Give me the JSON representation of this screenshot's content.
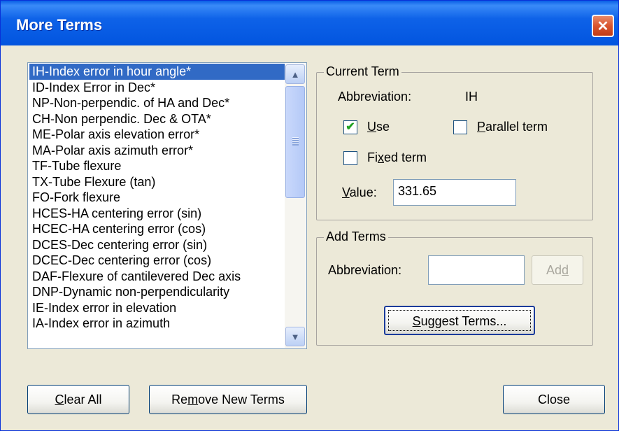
{
  "window": {
    "title": "More Terms",
    "close_glyph": "✕"
  },
  "terms_list": {
    "items": [
      "IH-Index error in hour angle*",
      "ID-Index Error in Dec*",
      "NP-Non-perpendic. of HA and Dec*",
      "CH-Non perpendic. Dec & OTA*",
      "ME-Polar axis elevation error*",
      "MA-Polar axis azimuth error*",
      "TF-Tube flexure",
      "TX-Tube Flexure (tan)",
      "FO-Fork flexure",
      "HCES-HA centering error (sin)",
      "HCEC-HA centering error (cos)",
      "DCES-Dec centering error (sin)",
      "DCEC-Dec centering error (cos)",
      "DAF-Flexure of cantilevered Dec axis",
      "DNP-Dynamic non-perpendicularity",
      "IE-Index error in elevation",
      "IA-Index error in azimuth"
    ],
    "selected_index": 0,
    "scroll_up_glyph": "▲",
    "scroll_down_glyph": "▼"
  },
  "current_term": {
    "group_label": "Current Term",
    "abbreviation_label": "Abbreviation:",
    "abbreviation_value": "IH",
    "use_label": {
      "pre": "",
      "u": "U",
      "post": "se"
    },
    "use_checked": true,
    "parallel_label": {
      "pre": "",
      "u": "P",
      "post": "arallel term"
    },
    "parallel_checked": false,
    "fixed_label": {
      "pre": "Fi",
      "u": "x",
      "post": "ed term"
    },
    "fixed_checked": false,
    "value_label": {
      "pre": "",
      "u": "V",
      "post": "alue:"
    },
    "value": "331.65",
    "check_glyph": "✔"
  },
  "add_terms": {
    "group_label": "Add Terms",
    "abbreviation_label": "Abbreviation:",
    "abbreviation_value": "",
    "add_button": {
      "pre": "Ad",
      "u": "d",
      "post": ""
    },
    "suggest_button": {
      "pre": "",
      "u": "S",
      "post": "uggest Terms..."
    }
  },
  "footer": {
    "clear_all": {
      "pre": "",
      "u": "C",
      "post": "lear All"
    },
    "remove_new": {
      "pre": "Re",
      "u": "m",
      "post": "ove New Terms"
    },
    "close": "Close"
  }
}
